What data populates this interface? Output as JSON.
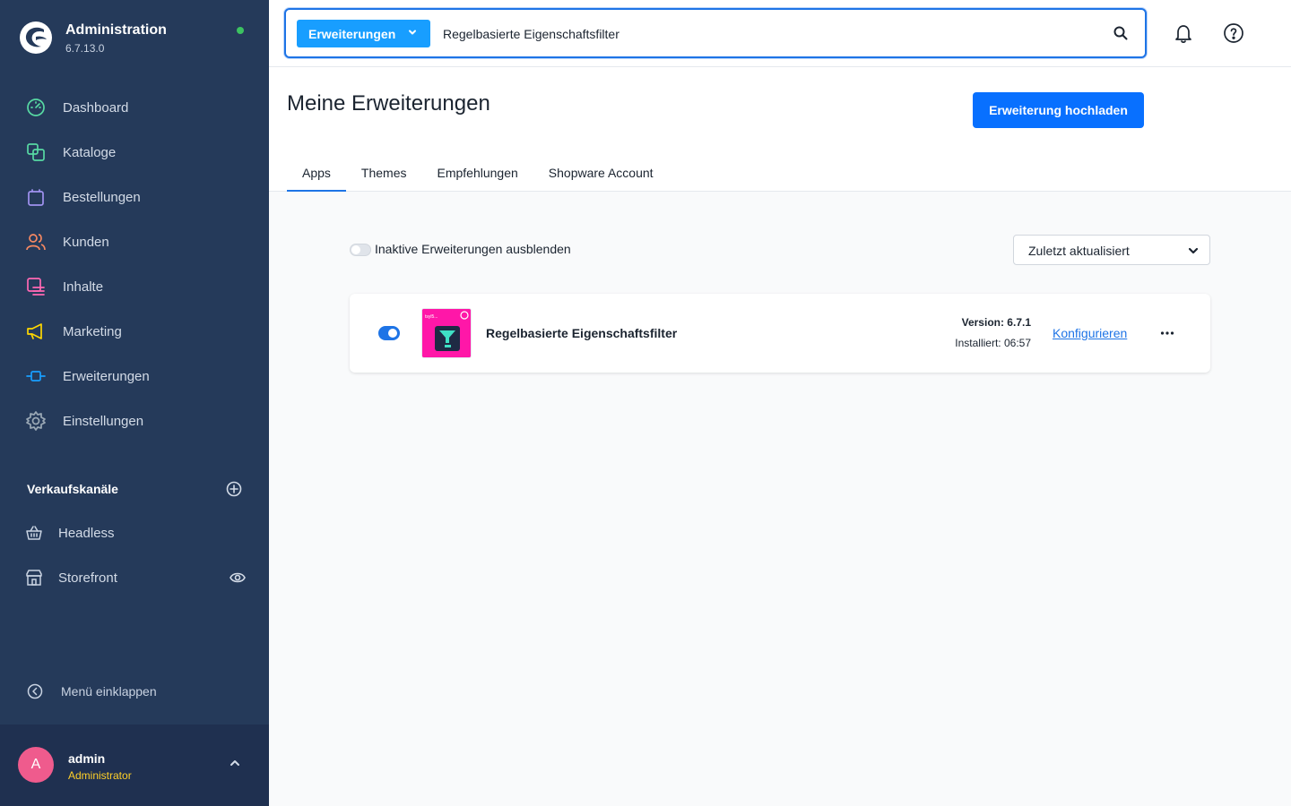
{
  "app": {
    "title": "Administration",
    "version": "6.7.13.0",
    "status": "online"
  },
  "sidebar": {
    "items": [
      {
        "label": "Dashboard",
        "icon": "dashboard-icon",
        "color": "#57d9a3"
      },
      {
        "label": "Kataloge",
        "icon": "catalog-icon",
        "color": "#57d9a3"
      },
      {
        "label": "Bestellungen",
        "icon": "orders-icon",
        "color": "#a092f0"
      },
      {
        "label": "Kunden",
        "icon": "customers-icon",
        "color": "#f88962"
      },
      {
        "label": "Inhalte",
        "icon": "content-icon",
        "color": "#ff68b4"
      },
      {
        "label": "Marketing",
        "icon": "marketing-icon",
        "color": "#ffd700"
      },
      {
        "label": "Erweiterungen",
        "icon": "extensions-icon",
        "color": "#189eff"
      },
      {
        "label": "Einstellungen",
        "icon": "settings-icon",
        "color": "#9aa8b5"
      }
    ],
    "sales_channels_title": "Verkaufskanäle",
    "channels": [
      {
        "label": "Headless",
        "icon": "basket-icon"
      },
      {
        "label": "Storefront",
        "icon": "storefront-icon"
      }
    ],
    "collapse_label": "Menü einklappen"
  },
  "user": {
    "initial": "A",
    "name": "admin",
    "role": "Administrator"
  },
  "search": {
    "type_label": "Erweiterungen",
    "value": "Regelbasierte Eigenschaftsfilter"
  },
  "page": {
    "title": "Meine Erweiterungen",
    "upload_label": "Erweiterung hochladen",
    "tabs": [
      {
        "label": "Apps",
        "active": true
      },
      {
        "label": "Themes",
        "active": false
      },
      {
        "label": "Empfehlungen",
        "active": false
      },
      {
        "label": "Shopware Account",
        "active": false
      }
    ]
  },
  "filters": {
    "hide_inactive_label": "Inaktive Erweiterungen ausblenden",
    "hide_inactive_on": false,
    "sort_value": "Zuletzt aktualisiert"
  },
  "extensions": [
    {
      "name": "Regelbasierte Eigenschaftsfilter",
      "active": true,
      "version": "Version: 6.7.1",
      "installed": "Installiert: 06:57",
      "configure_label": "Konfigurieren",
      "icon_text": "tsyl5..."
    }
  ],
  "colors": {
    "sidebar_bg": "#253a5a",
    "accent": "#1e74e6",
    "primary_button": "#0870ff",
    "search_type_bg": "#189eff",
    "extension_icon_bg": "#ff17a8",
    "user_role": "#ffd028",
    "avatar": "#ef5b8d"
  }
}
